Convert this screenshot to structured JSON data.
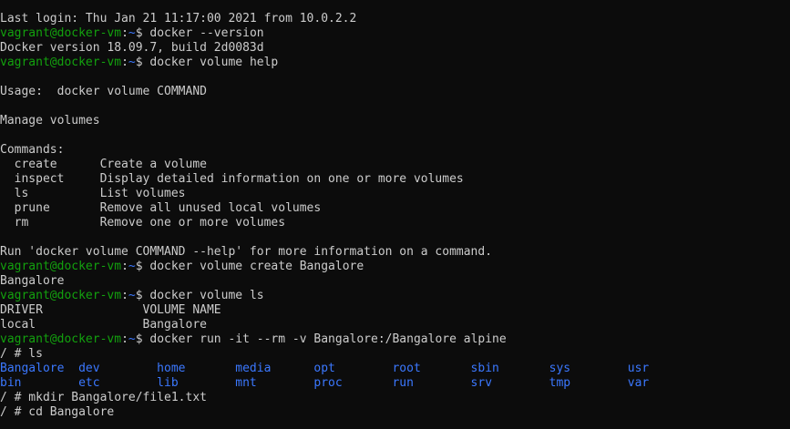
{
  "terminal": {
    "colors": {
      "background": "#0c0c0c",
      "foreground": "#cccccc",
      "prompt_user": "#13a10e",
      "prompt_path": "#3b78ff",
      "directory": "#3b78ff"
    },
    "lines": [
      [
        {
          "t": "Last login: Thu Jan 21 11:17:00 2021 from 10.0.2.2"
        }
      ],
      [
        {
          "t": "vagrant@docker-vm",
          "k": "p-user"
        },
        {
          "t": ":",
          "k": "p-sep"
        },
        {
          "t": "~",
          "k": "p-path"
        },
        {
          "t": "$ docker --version"
        }
      ],
      [
        {
          "t": "Docker version 18.09.7, build 2d0083d"
        }
      ],
      [
        {
          "t": "vagrant@docker-vm",
          "k": "p-user"
        },
        {
          "t": ":",
          "k": "p-sep"
        },
        {
          "t": "~",
          "k": "p-path"
        },
        {
          "t": "$ docker volume help"
        }
      ],
      [
        {
          "t": ""
        }
      ],
      [
        {
          "t": "Usage:  docker volume COMMAND"
        }
      ],
      [
        {
          "t": ""
        }
      ],
      [
        {
          "t": "Manage volumes"
        }
      ],
      [
        {
          "t": ""
        }
      ],
      [
        {
          "t": "Commands:"
        }
      ],
      [
        {
          "t": "  create      Create a volume"
        }
      ],
      [
        {
          "t": "  inspect     Display detailed information on one or more volumes"
        }
      ],
      [
        {
          "t": "  ls          List volumes"
        }
      ],
      [
        {
          "t": "  prune       Remove all unused local volumes"
        }
      ],
      [
        {
          "t": "  rm          Remove one or more volumes"
        }
      ],
      [
        {
          "t": ""
        }
      ],
      [
        {
          "t": "Run 'docker volume COMMAND --help' for more information on a command."
        }
      ],
      [
        {
          "t": "vagrant@docker-vm",
          "k": "p-user"
        },
        {
          "t": ":",
          "k": "p-sep"
        },
        {
          "t": "~",
          "k": "p-path"
        },
        {
          "t": "$ docker volume create Bangalore"
        }
      ],
      [
        {
          "t": "Bangalore"
        }
      ],
      [
        {
          "t": "vagrant@docker-vm",
          "k": "p-user"
        },
        {
          "t": ":",
          "k": "p-sep"
        },
        {
          "t": "~",
          "k": "p-path"
        },
        {
          "t": "$ docker volume ls"
        }
      ],
      [
        {
          "t": "DRIVER              VOLUME NAME"
        }
      ],
      [
        {
          "t": "local               Bangalore"
        }
      ],
      [
        {
          "t": "vagrant@docker-vm",
          "k": "p-user"
        },
        {
          "t": ":",
          "k": "p-sep"
        },
        {
          "t": "~",
          "k": "p-path"
        },
        {
          "t": "$ docker run -it --rm -v Bangalore:/Bangalore alpine"
        }
      ],
      [
        {
          "t": "/ # ls"
        }
      ],
      [
        {
          "t": "Bangalore  dev        home       media      opt        root       sbin       sys        usr",
          "k": "dir"
        }
      ],
      [
        {
          "t": "bin        etc        lib        mnt        proc       run        srv        tmp        var",
          "k": "dir"
        }
      ],
      [
        {
          "t": "/ # mkdir Bangalore/file1.txt"
        }
      ],
      [
        {
          "t": "/ # cd Bangalore"
        }
      ]
    ]
  }
}
